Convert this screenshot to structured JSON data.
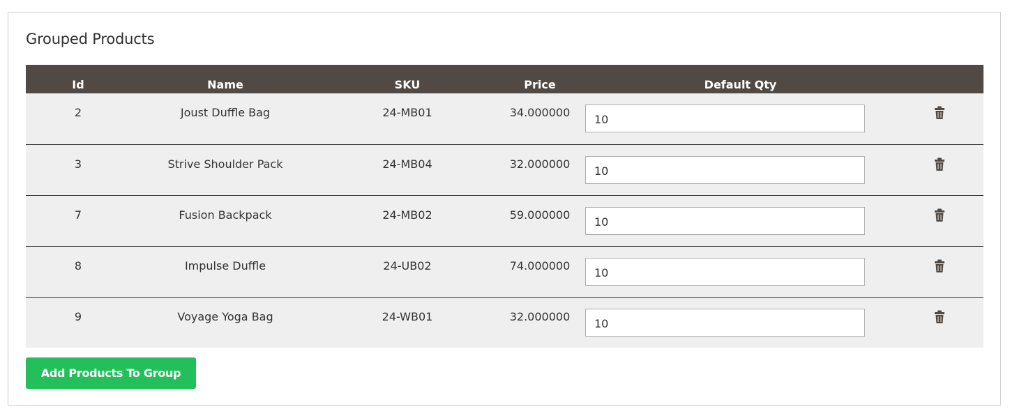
{
  "section": {
    "title": "Grouped Products"
  },
  "table": {
    "columns": {
      "id": "Id",
      "name": "Name",
      "sku": "SKU",
      "price": "Price",
      "default_qty": "Default Qty"
    },
    "rows": [
      {
        "id": "2",
        "name": "Joust Duffle Bag",
        "sku": "24-MB01",
        "price": "34.000000",
        "default_qty": "10"
      },
      {
        "id": "3",
        "name": "Strive Shoulder Pack",
        "sku": "24-MB04",
        "price": "32.000000",
        "default_qty": "10"
      },
      {
        "id": "7",
        "name": "Fusion Backpack",
        "sku": "24-MB02",
        "price": "59.000000",
        "default_qty": "10"
      },
      {
        "id": "8",
        "name": "Impulse Duffle",
        "sku": "24-UB02",
        "price": "74.000000",
        "default_qty": "10"
      },
      {
        "id": "9",
        "name": "Voyage Yoga Bag",
        "sku": "24-WB01",
        "price": "32.000000",
        "default_qty": "10"
      }
    ],
    "row_action_icon": "trash-icon"
  },
  "actions": {
    "add_label": "Add Products To Group"
  },
  "colors": {
    "header_bg": "#514943",
    "row_bg": "#efefef",
    "button_bg": "#22bf5b",
    "icon": "#514943"
  }
}
